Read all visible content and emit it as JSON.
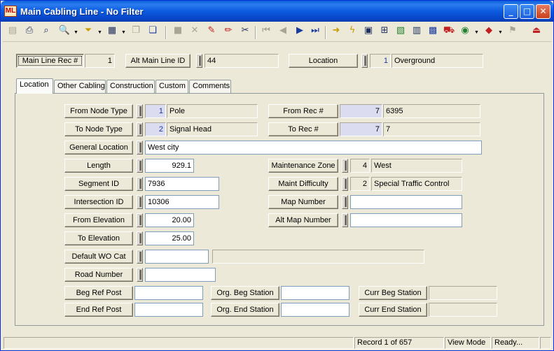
{
  "window": {
    "title": "Main Cabling Line - No Filter",
    "app_icon_text": "ML"
  },
  "title_buttons": {
    "minimize": "_",
    "maximize": "□",
    "close": "✕"
  },
  "toolbar": {
    "icons": [
      "record-icon",
      "print-icon",
      "preview-icon",
      "find-icon",
      "filter-icon",
      "form-icon",
      "copy-form-icon",
      "paste-icon",
      "save-icon",
      "delete-icon",
      "paint-icon",
      "edit-pencil-icon",
      "cut-icon",
      "first-record-icon",
      "previous-record-icon",
      "next-record-icon",
      "last-record-icon",
      "goto-arrow-icon",
      "lightning-icon",
      "attachments-icon",
      "network-icon",
      "photo-icon",
      "calculator-icon",
      "map-icon",
      "truck-icon",
      "globe-icon",
      "book-icon",
      "flag-icon",
      "exit-icon"
    ]
  },
  "header": {
    "main_line_rec_label": "Main Line Rec #",
    "main_line_rec_value": "1",
    "alt_main_line_id_label": "Alt Main Line ID",
    "alt_main_line_id_value": "44",
    "location_label": "Location",
    "location_code": "1",
    "location_value": "Overground"
  },
  "tabs": [
    {
      "label": "Location",
      "active": true
    },
    {
      "label": "Other Cabling",
      "active": false
    },
    {
      "label": "Construction",
      "active": false
    },
    {
      "label": "Custom",
      "active": false
    },
    {
      "label": "Comments",
      "active": false
    }
  ],
  "form": {
    "from_node_type": {
      "label": "From Node Type",
      "code": "1",
      "value": "Pole"
    },
    "to_node_type": {
      "label": "To Node Type",
      "code": "2",
      "value": "Signal Head"
    },
    "general_location": {
      "label": "General Location",
      "value": "West city"
    },
    "length": {
      "label": "Length",
      "value": "929.1"
    },
    "segment_id": {
      "label": "Segment ID",
      "value": "7936"
    },
    "intersection_id": {
      "label": "Intersection ID",
      "value": "10306"
    },
    "from_elevation": {
      "label": "From Elevation",
      "value": "20.00"
    },
    "to_elevation": {
      "label": "To Elevation",
      "value": "25.00"
    },
    "default_wo_cat": {
      "label": "Default WO Cat",
      "value": "",
      "description": ""
    },
    "road_number": {
      "label": "Road Number",
      "value": ""
    },
    "from_rec": {
      "label": "From Rec #",
      "code": "7",
      "value": "6395"
    },
    "to_rec": {
      "label": "To Rec #",
      "code": "7",
      "value": "7"
    },
    "maintenance_zone": {
      "label": "Maintenance Zone",
      "code": "4",
      "value": "West"
    },
    "maint_difficulty": {
      "label": "Maint Difficulty",
      "code": "2",
      "value": "Special Traffic Control"
    },
    "map_number": {
      "label": "Map Number",
      "value": ""
    },
    "alt_map_number": {
      "label": "Alt Map Number",
      "value": ""
    },
    "beg_ref_post": {
      "label": "Beg Ref Post",
      "value": ""
    },
    "end_ref_post": {
      "label": "End Ref Post",
      "value": ""
    },
    "org_beg_station": {
      "label": "Org. Beg Station",
      "value": ""
    },
    "org_end_station": {
      "label": "Org. End Station",
      "value": ""
    },
    "curr_beg_station": {
      "label": "Curr Beg Station",
      "value": ""
    },
    "curr_end_station": {
      "label": "Curr End Station",
      "value": ""
    }
  },
  "status": {
    "pane1": "",
    "record": "Record 1 of 657",
    "mode": "View Mode",
    "state": "Ready..."
  }
}
